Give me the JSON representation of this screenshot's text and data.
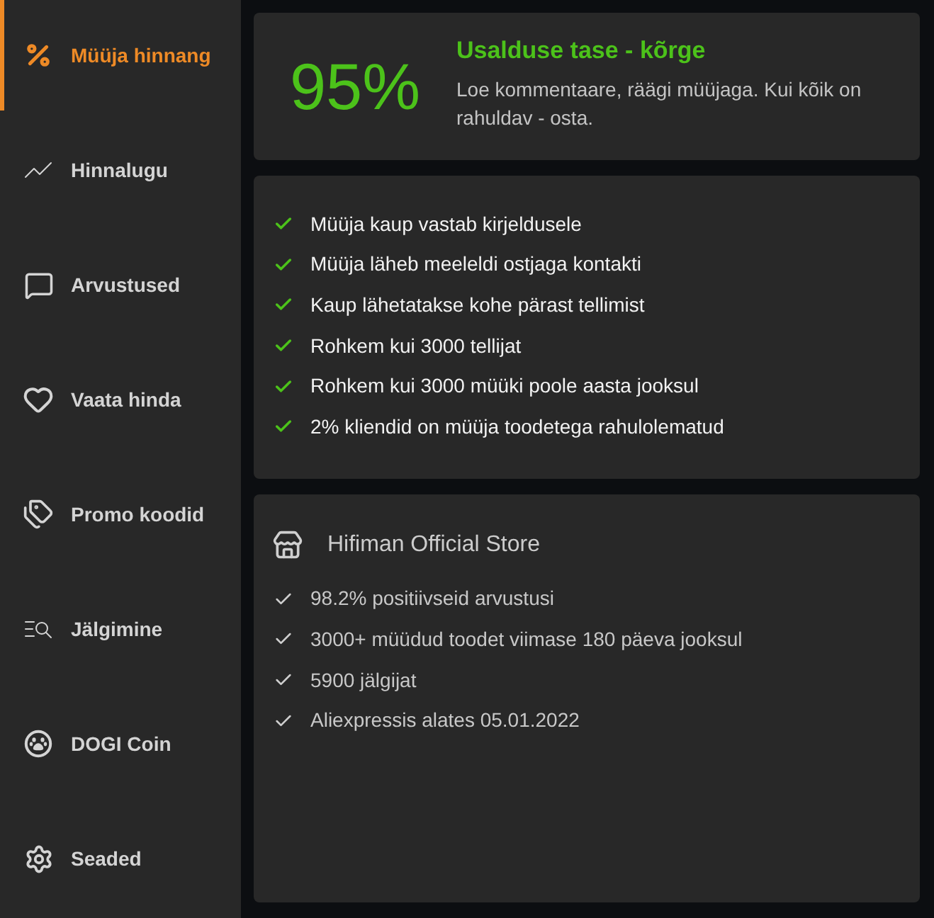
{
  "sidebar": {
    "items": [
      {
        "label": "Müüja hinnang",
        "selected": true
      },
      {
        "label": "Hinnalugu",
        "selected": false
      },
      {
        "label": "Arvustused",
        "selected": false
      },
      {
        "label": "Vaata hinda",
        "selected": false
      },
      {
        "label": "Promo koodid",
        "selected": false
      },
      {
        "label": "Jälgimine",
        "selected": false
      },
      {
        "label": "DOGI Coin",
        "selected": false
      },
      {
        "label": "Seaded",
        "selected": false
      }
    ]
  },
  "trust": {
    "score": "95%",
    "title": "Usalduse tase - kõrge",
    "description": "Loe kommentaare, räägi müüjaga. Kui kõik on rahuldav - osta."
  },
  "criteria": [
    "Müüja kaup vastab kirjeldusele",
    "Müüja läheb meeleldi ostjaga kontakti",
    "Kaup lähetatakse kohe pärast tellimist",
    "Rohkem kui 3000 tellijat",
    "Rohkem kui 3000 müüki poole aasta jooksul",
    "2% kliendid on müüja toodetega rahulolematud"
  ],
  "store": {
    "name": "Hifiman Official Store",
    "facts": [
      "98.2% positiivseid arvustusi",
      "3000+ müüdud toodet viimase 180 päeva jooksul",
      "5900 jälgijat",
      "Aliexpressis alates 05.01.2022"
    ]
  }
}
